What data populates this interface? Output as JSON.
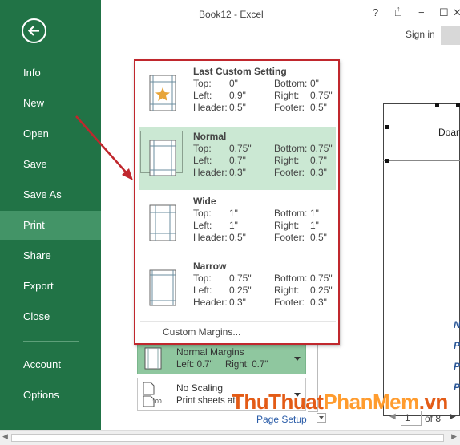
{
  "window": {
    "title": "Book12 - Excel",
    "help": "?",
    "minimize": "−",
    "restore": "☐",
    "close": "✕",
    "signin": "Sign in"
  },
  "sidebar": {
    "items": [
      {
        "label": "Info"
      },
      {
        "label": "New"
      },
      {
        "label": "Open"
      },
      {
        "label": "Save"
      },
      {
        "label": "Save As"
      },
      {
        "label": "Print"
      },
      {
        "label": "Share"
      },
      {
        "label": "Export"
      },
      {
        "label": "Close"
      },
      {
        "label": "Account"
      },
      {
        "label": "Options"
      }
    ],
    "active": "Print"
  },
  "margins_dropdown": {
    "options": [
      {
        "title": "Last Custom Setting",
        "top_label": "Top:",
        "top": "0\"",
        "bottom_label": "Bottom:",
        "bottom": "0\"",
        "left_label": "Left:",
        "left": "0.9\"",
        "right_label": "Right:",
        "right": "0.75\"",
        "header_label": "Header:",
        "header": "0.5\"",
        "footer_label": "Footer:",
        "footer": "0.5\""
      },
      {
        "title": "Normal",
        "top_label": "Top:",
        "top": "0.75\"",
        "bottom_label": "Bottom:",
        "bottom": "0.75\"",
        "left_label": "Left:",
        "left": "0.7\"",
        "right_label": "Right:",
        "right": "0.7\"",
        "header_label": "Header:",
        "header": "0.3\"",
        "footer_label": "Footer:",
        "footer": "0.3\""
      },
      {
        "title": "Wide",
        "top_label": "Top:",
        "top": "1\"",
        "bottom_label": "Bottom:",
        "bottom": "1\"",
        "left_label": "Left:",
        "left": "1\"",
        "right_label": "Right:",
        "right": "1\"",
        "header_label": "Header:",
        "header": "0.5\"",
        "footer_label": "Footer:",
        "footer": "0.5\""
      },
      {
        "title": "Narrow",
        "top_label": "Top:",
        "top": "0.75\"",
        "bottom_label": "Bottom:",
        "bottom": "0.75\"",
        "left_label": "Left:",
        "left": "0.25\"",
        "right_label": "Right:",
        "right": "0.25\"",
        "header_label": "Header:",
        "header": "0.3\"",
        "footer_label": "Footer:",
        "footer": "0.3\""
      }
    ],
    "custom": "Custom Margins..."
  },
  "settings": {
    "margins_main": "Normal Margins",
    "margins_left": "Left: 0.7\"",
    "margins_right": "Right: 0.7\"",
    "scaling_main": "No Scaling",
    "scaling_sub": "Print sheets at",
    "scaling_icon_text": "100",
    "page_setup": "Page Setup"
  },
  "preview": {
    "cell_text": "Doan",
    "row_letters": [
      "N",
      "P",
      "P",
      "P"
    ]
  },
  "pager": {
    "current": "1",
    "of": "of 8"
  },
  "watermark": {
    "part1": "ThuThuat",
    "part2": "PhanMem",
    "part3": ".vn"
  },
  "colors": {
    "sidebar": "#217346",
    "sidebar_active": "#439467",
    "highlight": "#c0272d",
    "selected_option": "#cbe8d3"
  }
}
